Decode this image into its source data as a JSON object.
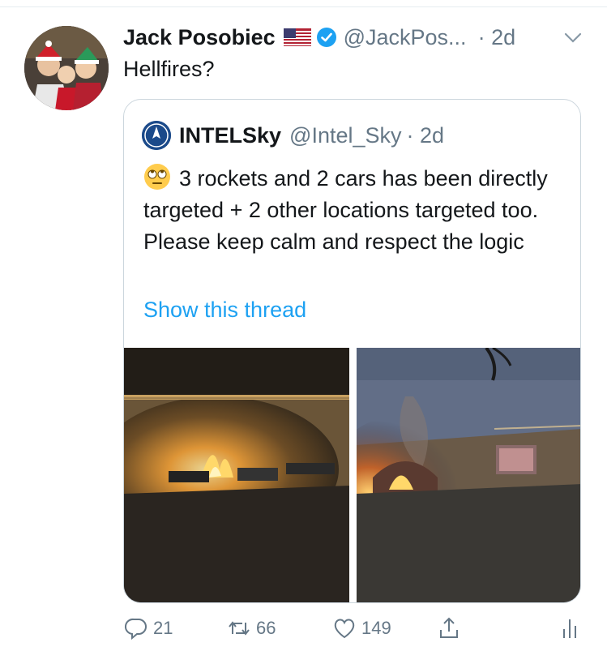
{
  "tweet": {
    "author_name": "Jack Posobiec",
    "author_handle": "@JackPos...",
    "time": "· 2d",
    "text": "Hellfires?",
    "flag_icon": "us-flag-icon",
    "verified_icon": "verified-badge-icon",
    "menu_icon": "chevron-down-icon"
  },
  "quote": {
    "author_name": "INTELSky",
    "author_handle": "@Intel_Sky",
    "time": "· 2d",
    "emoji": "eye-roll-emoji",
    "text": "3 rockets and 2 cars has been directly targeted + 2 other locations targeted too. Please keep calm and respect the logic",
    "show_thread": "Show this thread"
  },
  "actions": {
    "reply_count": "21",
    "retweet_count": "66",
    "like_count": "149"
  },
  "colors": {
    "link": "#1da1f2",
    "secondary_text": "#657786",
    "border": "#ccd6dd",
    "verified": "#1da1f2"
  }
}
